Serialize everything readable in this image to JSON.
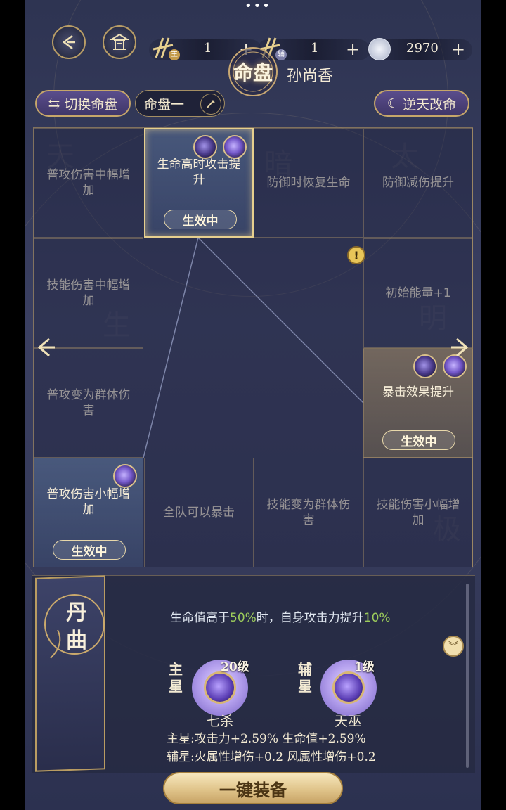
{
  "header": {
    "dots": "•••",
    "main_res_value": "1",
    "main_res_badge": "主",
    "aux_res_value": "1",
    "aux_res_badge": "辅",
    "coin_value": "2970",
    "plus": "+",
    "title": "命盘",
    "character_name": "孙尚香"
  },
  "toolbar": {
    "switch_label": "切换命盘",
    "current_plate": "命盘一",
    "reverse_label": "逆天改命"
  },
  "grid": {
    "cells": [
      {
        "label": "普攻伤害中幅增加"
      },
      {
        "label": "生命高时攻击提升",
        "effect": "生效中"
      },
      {
        "label": "防御时恢复生命"
      },
      {
        "label": "防御减伤提升"
      },
      {
        "label": "技能伤害中幅增加"
      },
      {
        "label": "初始能量+1"
      },
      {
        "label": "普攻变为群体伤害"
      },
      {
        "label": "暴击效果提升",
        "effect": "生效中"
      },
      {
        "label": "普攻伤害小幅增加",
        "effect": "生效中"
      },
      {
        "label": "全队可以暴击"
      },
      {
        "label": "技能变为群体伤害"
      },
      {
        "label": "技能伤害小幅增加"
      }
    ],
    "warning_symbol": "!"
  },
  "detail": {
    "banner_title": "丹曲",
    "desc_prefix": "生命值高于",
    "desc_hl1": "50%",
    "desc_mid": "时，自身攻击力提升",
    "desc_hl2": "10%",
    "main_star_label": "主星",
    "main_star_level": "20级",
    "main_star_name": "七杀",
    "aux_star_label": "辅星",
    "aux_star_level": "1级",
    "aux_star_name": "天巫",
    "stat_main": "主星:攻击力+2.59% 生命值+2.59%",
    "stat_aux": "辅星:火属性增伤+0.2 风属性增伤+0.2"
  },
  "equip_label": "一键装备",
  "colors": {
    "accent_gold": "#c6a66a",
    "highlight_green": "#9ccc5b"
  }
}
